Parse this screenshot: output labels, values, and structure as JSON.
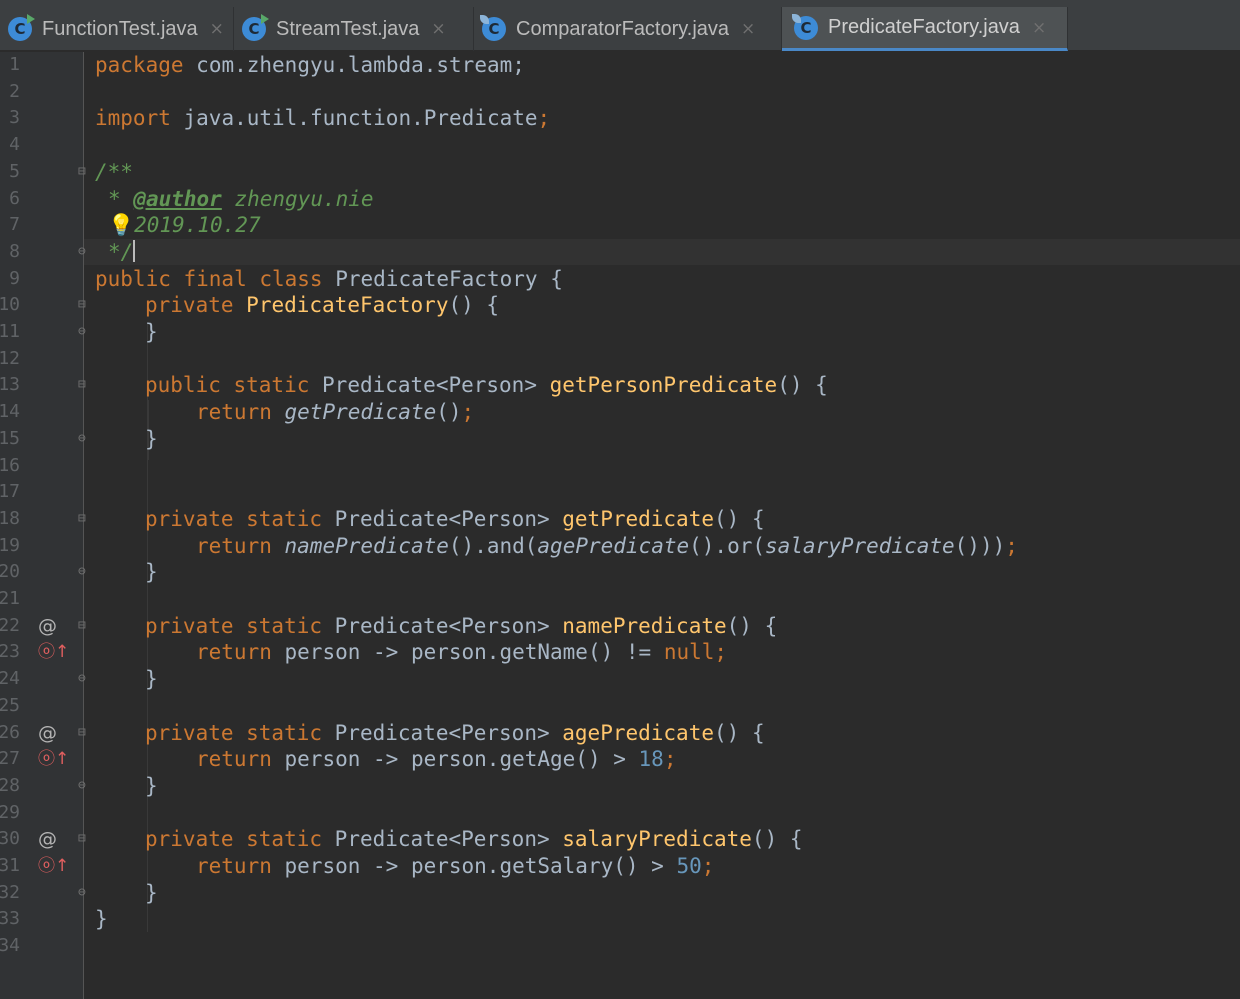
{
  "tabs": [
    {
      "label": "FunctionTest.java",
      "icon": "run-class-icon"
    },
    {
      "label": "StreamTest.java",
      "icon": "run-class-icon"
    },
    {
      "label": "ComparatorFactory.java",
      "icon": "class-icon"
    },
    {
      "label": "PredicateFactory.java",
      "icon": "class-icon",
      "active": true
    }
  ],
  "tab_close_glyph": "×",
  "class_icon_glyph": "C",
  "editor": {
    "line_numbers": [
      "1",
      "2",
      "3",
      "4",
      "5",
      "6",
      "7",
      "8",
      "9",
      "10",
      "11",
      "12",
      "13",
      "14",
      "15",
      "16",
      "17",
      "18",
      "19",
      "20",
      "21",
      "22",
      "23",
      "24",
      "25",
      "26",
      "27",
      "28",
      "29",
      "30",
      "31",
      "32",
      "33",
      "34"
    ],
    "gutter_markers": {
      "at": "@",
      "implements": "ⓞ↑"
    },
    "code": {
      "package_kw": "package",
      "package_name": "com.zhengyu.lambda.stream;",
      "import_kw": "import",
      "import_name": "java.util.function.Predicate",
      "semicolon": ";",
      "doc_open": "/**",
      "doc_star": "* ",
      "author_tag": "@author",
      "author_name": "zhengyu.nie",
      "bulb": "💡",
      "doc_date": "2019.10.27",
      "doc_close": "*/",
      "public_final_class": "public final class",
      "class_name": "PredicateFactory",
      "open_brace": "{",
      "close_brace": "}",
      "private_kw": "private",
      "ctor_name": "PredicateFactory",
      "empty_parens": "()",
      "public_static": "public static",
      "private_static": "private static",
      "return_type": "Predicate<Person>",
      "return_kw": "return",
      "m1_name": "getPersonPredicate",
      "m1_call": "getPredicate",
      "m2_name": "getPredicate",
      "m2_call_a": "namePredicate",
      "m2_and": ".and(",
      "m2_call_b": "agePredicate",
      "m2_or": ".or(",
      "m2_call_c": "salaryPredicate",
      "m2_tail": "()))",
      "m3_name": "namePredicate",
      "lambda_head": "person -> person.",
      "m3_call": "getName() != ",
      "null_kw": "null",
      "m4_name": "agePredicate",
      "m4_call": "getAge() > ",
      "m4_value": "18",
      "m5_name": "salaryPredicate",
      "m5_call": "getSalary() > ",
      "m5_value": "50"
    }
  },
  "colors": {
    "background": "#2b2b2b",
    "keyword": "#cc7832",
    "method": "#ffc66d",
    "number": "#6897bb",
    "doc_comment": "#629755",
    "text": "#a9b7c6",
    "active_tab_underline": "#4a88c7"
  }
}
